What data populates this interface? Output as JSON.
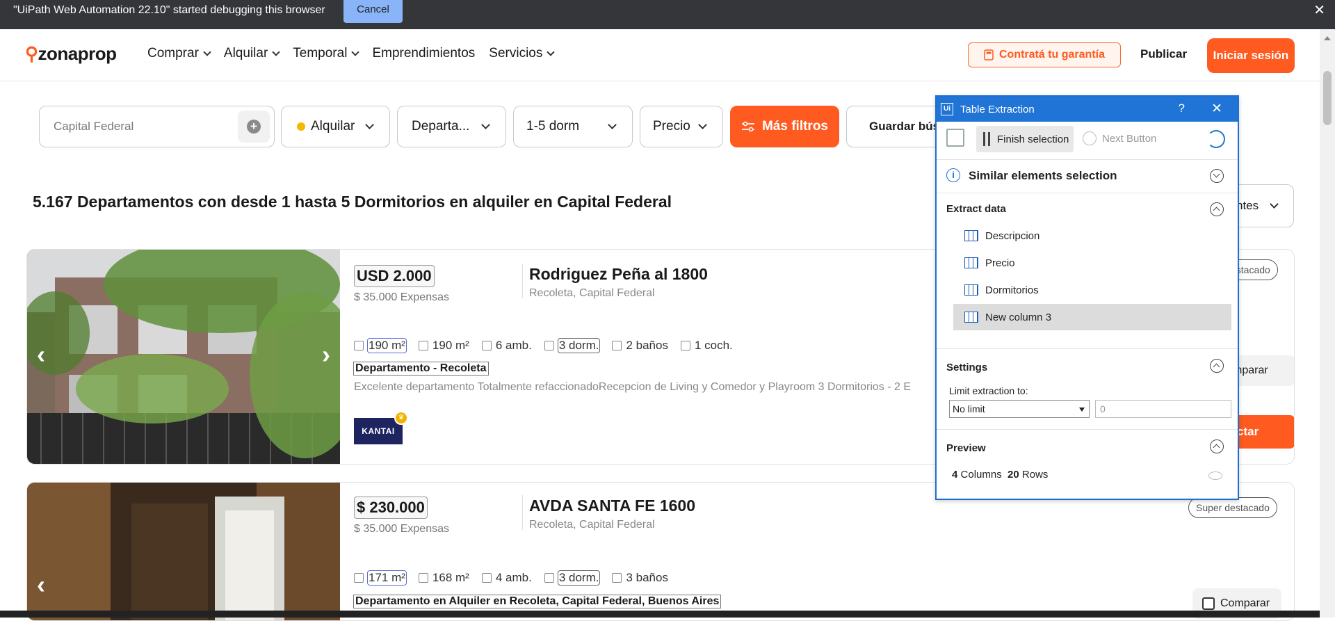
{
  "debug": {
    "message": "\"UiPath Web Automation 22.10\" started debugging this browser",
    "cancel": "Cancel",
    "close": "✕"
  },
  "header": {
    "logo": "zonaprop",
    "nav": [
      {
        "label": "Comprar",
        "dropdown": true
      },
      {
        "label": "Alquilar",
        "dropdown": true
      },
      {
        "label": "Temporal",
        "dropdown": true
      },
      {
        "label": "Emprendimientos",
        "dropdown": false
      },
      {
        "label": "Servicios",
        "dropdown": true
      }
    ],
    "garantia": "Contratá tu garantía",
    "publicar": "Publicar",
    "login": "Iniciar sesión"
  },
  "filters": {
    "location_placeholder": "Capital Federal",
    "operation": "Alquilar",
    "type": "Departa...",
    "rooms": "1-5 dorm",
    "price": "Precio",
    "more": "Más filtros",
    "save": "Guardar bús"
  },
  "results_title": "5.167 Departamentos con desde 1 hasta 5 Dormitorios en alquiler en Capital Federal",
  "sort_label": "ntes",
  "listings": [
    {
      "price": "USD 2.000",
      "expensas": "$ 35.000 Expensas",
      "address": "Rodriguez Peña al 1800",
      "location": "Recoleta, Capital Federal",
      "features": [
        "190 m²",
        "190 m²",
        "6 amb.",
        "3 dorm.",
        "2 baños",
        "1 coch."
      ],
      "title": "Departamento - Recoleta",
      "description": "Excelente departamento Totalmente refaccionadoRecepcion de Living y Comedor y Playroom 3 Dormitorios - 2 E",
      "agency": "KANTAI",
      "badge": "estacado",
      "compare": "mparar",
      "contact": "ctar"
    },
    {
      "price": "$ 230.000",
      "expensas": "$ 35.000 Expensas",
      "address": "AVDA SANTA FE 1600",
      "location": "Recoleta, Capital Federal",
      "features": [
        "171 m²",
        "168 m²",
        "4 amb.",
        "3 dorm.",
        "3 baños"
      ],
      "title": "Departamento en Alquiler en Recoleta, Capital Federal, Buenos Aires",
      "badge": "Super destacado",
      "compare": "Comparar"
    }
  ],
  "panel": {
    "title": "Table Extraction",
    "help": "?",
    "close": "✕",
    "finish": "Finish selection",
    "next": "Next Button",
    "similar": "Similar elements selection",
    "extract": "Extract data",
    "columns": [
      "Descripcion",
      "Precio",
      "Dormitorios",
      "New column 3"
    ],
    "settings": "Settings",
    "limit_label": "Limit extraction to:",
    "limit_value": "No limit",
    "limit_number": "0",
    "preview": "Preview",
    "columns_count": "4",
    "columns_word": "Columns",
    "rows_count": "20",
    "rows_word": "Rows"
  }
}
